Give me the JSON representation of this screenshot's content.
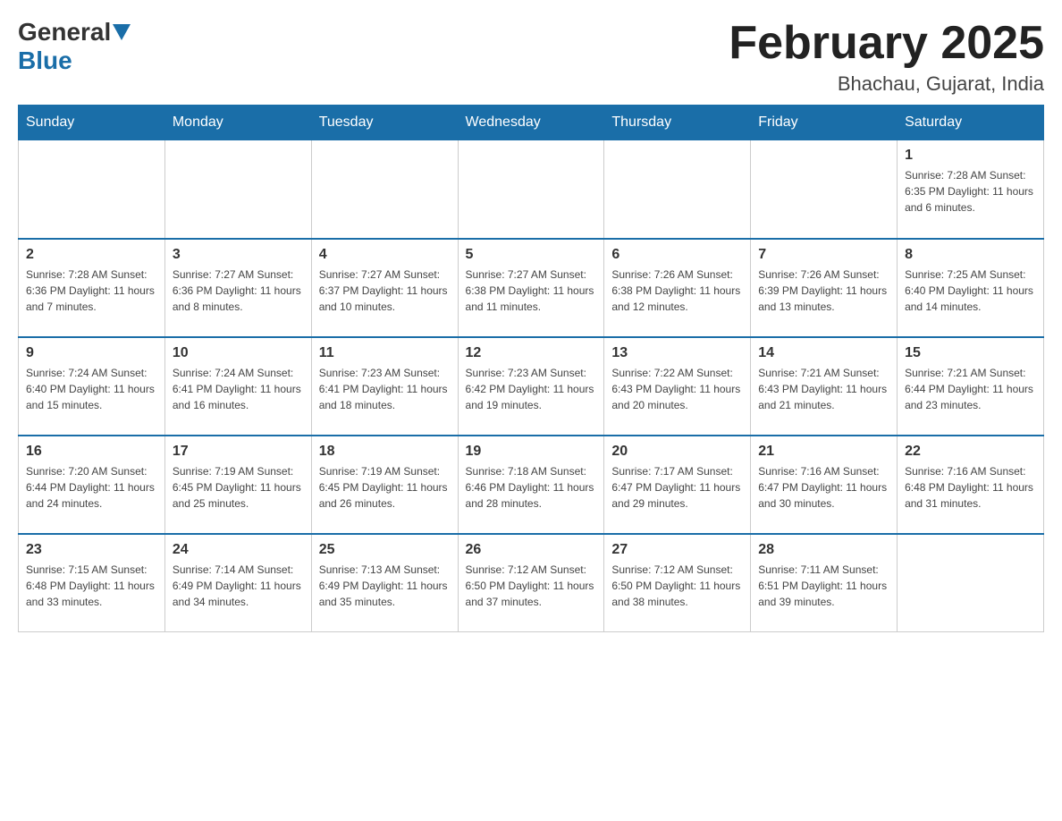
{
  "header": {
    "logo_general": "General",
    "logo_blue": "Blue",
    "month_title": "February 2025",
    "location": "Bhachau, Gujarat, India"
  },
  "days_of_week": [
    "Sunday",
    "Monday",
    "Tuesday",
    "Wednesday",
    "Thursday",
    "Friday",
    "Saturday"
  ],
  "weeks": [
    {
      "days": [
        {
          "num": "",
          "info": ""
        },
        {
          "num": "",
          "info": ""
        },
        {
          "num": "",
          "info": ""
        },
        {
          "num": "",
          "info": ""
        },
        {
          "num": "",
          "info": ""
        },
        {
          "num": "",
          "info": ""
        },
        {
          "num": "1",
          "info": "Sunrise: 7:28 AM\nSunset: 6:35 PM\nDaylight: 11 hours and 6 minutes."
        }
      ]
    },
    {
      "days": [
        {
          "num": "2",
          "info": "Sunrise: 7:28 AM\nSunset: 6:36 PM\nDaylight: 11 hours and 7 minutes."
        },
        {
          "num": "3",
          "info": "Sunrise: 7:27 AM\nSunset: 6:36 PM\nDaylight: 11 hours and 8 minutes."
        },
        {
          "num": "4",
          "info": "Sunrise: 7:27 AM\nSunset: 6:37 PM\nDaylight: 11 hours and 10 minutes."
        },
        {
          "num": "5",
          "info": "Sunrise: 7:27 AM\nSunset: 6:38 PM\nDaylight: 11 hours and 11 minutes."
        },
        {
          "num": "6",
          "info": "Sunrise: 7:26 AM\nSunset: 6:38 PM\nDaylight: 11 hours and 12 minutes."
        },
        {
          "num": "7",
          "info": "Sunrise: 7:26 AM\nSunset: 6:39 PM\nDaylight: 11 hours and 13 minutes."
        },
        {
          "num": "8",
          "info": "Sunrise: 7:25 AM\nSunset: 6:40 PM\nDaylight: 11 hours and 14 minutes."
        }
      ]
    },
    {
      "days": [
        {
          "num": "9",
          "info": "Sunrise: 7:24 AM\nSunset: 6:40 PM\nDaylight: 11 hours and 15 minutes."
        },
        {
          "num": "10",
          "info": "Sunrise: 7:24 AM\nSunset: 6:41 PM\nDaylight: 11 hours and 16 minutes."
        },
        {
          "num": "11",
          "info": "Sunrise: 7:23 AM\nSunset: 6:41 PM\nDaylight: 11 hours and 18 minutes."
        },
        {
          "num": "12",
          "info": "Sunrise: 7:23 AM\nSunset: 6:42 PM\nDaylight: 11 hours and 19 minutes."
        },
        {
          "num": "13",
          "info": "Sunrise: 7:22 AM\nSunset: 6:43 PM\nDaylight: 11 hours and 20 minutes."
        },
        {
          "num": "14",
          "info": "Sunrise: 7:21 AM\nSunset: 6:43 PM\nDaylight: 11 hours and 21 minutes."
        },
        {
          "num": "15",
          "info": "Sunrise: 7:21 AM\nSunset: 6:44 PM\nDaylight: 11 hours and 23 minutes."
        }
      ]
    },
    {
      "days": [
        {
          "num": "16",
          "info": "Sunrise: 7:20 AM\nSunset: 6:44 PM\nDaylight: 11 hours and 24 minutes."
        },
        {
          "num": "17",
          "info": "Sunrise: 7:19 AM\nSunset: 6:45 PM\nDaylight: 11 hours and 25 minutes."
        },
        {
          "num": "18",
          "info": "Sunrise: 7:19 AM\nSunset: 6:45 PM\nDaylight: 11 hours and 26 minutes."
        },
        {
          "num": "19",
          "info": "Sunrise: 7:18 AM\nSunset: 6:46 PM\nDaylight: 11 hours and 28 minutes."
        },
        {
          "num": "20",
          "info": "Sunrise: 7:17 AM\nSunset: 6:47 PM\nDaylight: 11 hours and 29 minutes."
        },
        {
          "num": "21",
          "info": "Sunrise: 7:16 AM\nSunset: 6:47 PM\nDaylight: 11 hours and 30 minutes."
        },
        {
          "num": "22",
          "info": "Sunrise: 7:16 AM\nSunset: 6:48 PM\nDaylight: 11 hours and 31 minutes."
        }
      ]
    },
    {
      "days": [
        {
          "num": "23",
          "info": "Sunrise: 7:15 AM\nSunset: 6:48 PM\nDaylight: 11 hours and 33 minutes."
        },
        {
          "num": "24",
          "info": "Sunrise: 7:14 AM\nSunset: 6:49 PM\nDaylight: 11 hours and 34 minutes."
        },
        {
          "num": "25",
          "info": "Sunrise: 7:13 AM\nSunset: 6:49 PM\nDaylight: 11 hours and 35 minutes."
        },
        {
          "num": "26",
          "info": "Sunrise: 7:12 AM\nSunset: 6:50 PM\nDaylight: 11 hours and 37 minutes."
        },
        {
          "num": "27",
          "info": "Sunrise: 7:12 AM\nSunset: 6:50 PM\nDaylight: 11 hours and 38 minutes."
        },
        {
          "num": "28",
          "info": "Sunrise: 7:11 AM\nSunset: 6:51 PM\nDaylight: 11 hours and 39 minutes."
        },
        {
          "num": "",
          "info": ""
        }
      ]
    }
  ]
}
